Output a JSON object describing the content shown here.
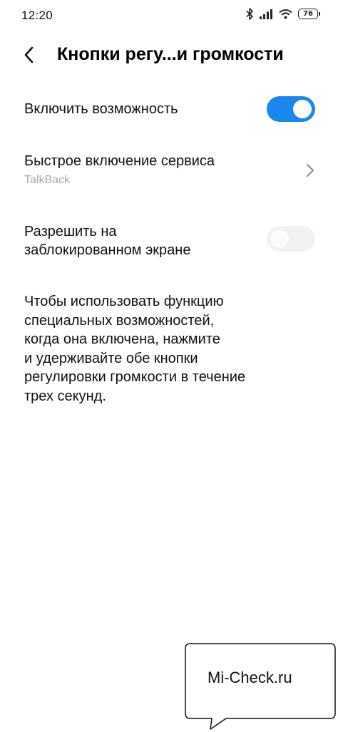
{
  "status_bar": {
    "time": "12:20",
    "battery_level": "76",
    "icons": [
      "bluetooth-icon",
      "signal-icon",
      "wifi-icon",
      "battery-icon"
    ]
  },
  "header": {
    "title": "Кнопки регу...и громкости",
    "back_icon": "chevron-left-icon"
  },
  "settings": {
    "enable": {
      "label": "Включить возможность",
      "enabled": true
    },
    "quick_service": {
      "label": "Быстрое включение сервиса",
      "value": "TalkBack",
      "icon": "chevron-right-icon"
    },
    "lock_screen": {
      "label_line1": "Разрешить на",
      "label_line2": "заблокированном экране",
      "enabled": false
    }
  },
  "description": {
    "lines": [
      "Чтобы использовать функцию",
      "специальных возможностей,",
      "когда она включена, нажмите",
      "и удерживайте обе кнопки",
      "регулировки громкости в течение",
      "трех секунд."
    ]
  },
  "watermark": {
    "text": "Mi-Check.ru"
  },
  "colors": {
    "accent": "#1a87ee",
    "toggle_off": "#f2f2f2",
    "secondary_text": "#a8a8a8"
  }
}
